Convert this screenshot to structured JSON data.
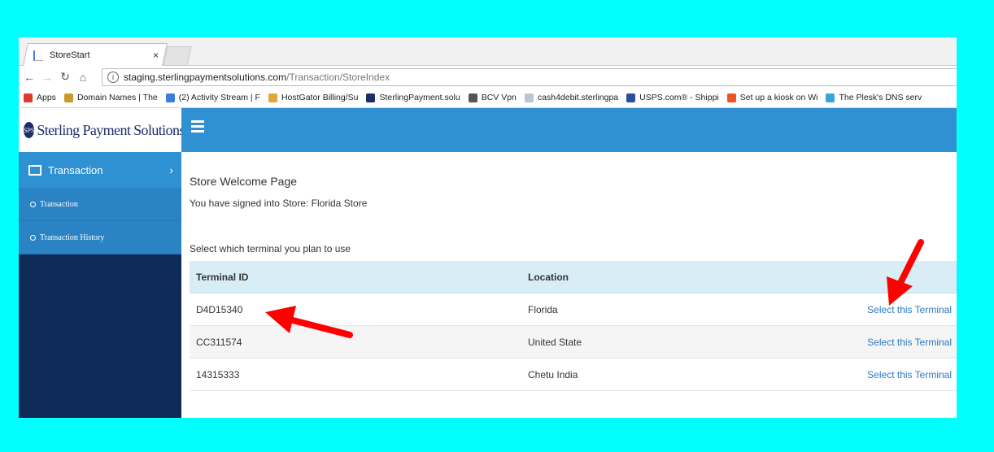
{
  "browser": {
    "tab_title": "StoreStart",
    "tab_close": "×",
    "url_host": "staging.sterlingpaymentsolutions.com",
    "url_path": "/Transaction/StoreIndex",
    "bookmarks": [
      {
        "label": "Apps",
        "icon": "apps-grid-icon",
        "color": "#e0392b"
      },
      {
        "label": "Domain Names | The",
        "icon": "domain-icon",
        "color": "#c89a2a"
      },
      {
        "label": "(2) Activity Stream | F",
        "icon": "activity-stream-icon",
        "color": "#3b7dd8"
      },
      {
        "label": "HostGator Billing/Su",
        "icon": "hostgator-icon",
        "color": "#e2a33a"
      },
      {
        "label": "SterlingPayment.solu",
        "icon": "sterling-icon",
        "color": "#1b2d6b"
      },
      {
        "label": "BCV Vpn",
        "icon": "vpn-icon",
        "color": "#555555"
      },
      {
        "label": "cash4debit.sterlingpa",
        "icon": "page-icon",
        "color": "#b9c6d6"
      },
      {
        "label": "USPS.com® - Shippi",
        "icon": "usps-icon",
        "color": "#2b4d9a"
      },
      {
        "label": "Set up a kiosk on Wi",
        "icon": "windows-icon",
        "color": "#f25022"
      },
      {
        "label": "The Plesk's DNS serv",
        "icon": "plesk-icon",
        "color": "#3aa3d8"
      }
    ]
  },
  "brand": {
    "logo_text": "SPS",
    "name": "Sterling Payment Solutions, LLC"
  },
  "sidebar": {
    "main_label": "Transaction",
    "chevron": "›",
    "items": [
      {
        "label": "Transaction"
      },
      {
        "label": "Transaction History"
      }
    ]
  },
  "content": {
    "title": "Store Welcome Page",
    "signed_in": "You have signed into Store: Florida Store",
    "select_prompt": "Select which terminal you plan to use",
    "columns": [
      "Terminal ID",
      "Location",
      ""
    ],
    "rows": [
      {
        "id": "D4D15340",
        "location": "Florida",
        "action": "Select this Terminal"
      },
      {
        "id": "CC311574",
        "location": "United State",
        "action": "Select this Terminal"
      },
      {
        "id": "14315333",
        "location": "Chetu India",
        "action": "Select this Terminal"
      }
    ]
  },
  "colors": {
    "background": "#00ffff",
    "accent": "#3091d2",
    "sidebar": "#0d2b56",
    "annotation_arrow": "#ff0000"
  }
}
